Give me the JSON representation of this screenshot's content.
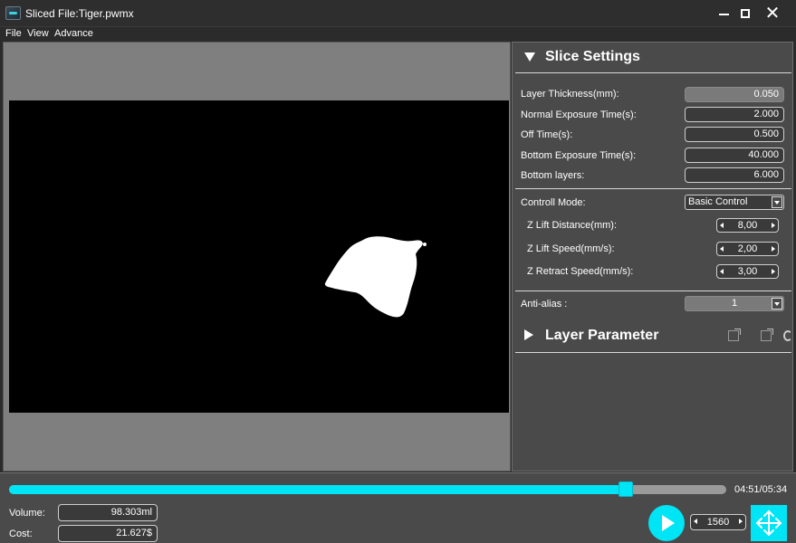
{
  "window": {
    "title": "Sliced File:Tiger.pwmx",
    "close_glyph": "✕"
  },
  "menu": [
    "File",
    "View",
    "Advance"
  ],
  "slice_settings": {
    "title": "Slice Settings",
    "layer_thickness": {
      "label": "Layer Thickness(mm):",
      "value": "0.050"
    },
    "normal_exposure": {
      "label": "Normal Exposure Time(s):",
      "value": "2.000"
    },
    "off_time": {
      "label": "Off Time(s):",
      "value": "0.500"
    },
    "bottom_exposure": {
      "label": "Bottom Exposure Time(s):",
      "value": "40.000"
    },
    "bottom_layers": {
      "label": "Bottom layers:",
      "value": "6.000"
    },
    "control_mode": {
      "label": "Controll Mode:",
      "value": "Basic Control"
    },
    "z_lift_distance": {
      "label": "Z Lift Distance(mm):",
      "value": "8,00"
    },
    "z_lift_speed": {
      "label": "Z Lift Speed(mm/s):",
      "value": "2,00"
    },
    "z_retract_speed": {
      "label": "Z Retract Speed(mm/s):",
      "value": "3,00"
    },
    "anti_alias": {
      "label": "Anti-alias :",
      "value": "1"
    }
  },
  "layer_parameter": {
    "title": "Layer Parameter"
  },
  "playback": {
    "time": "04:51/05:34",
    "progress": 0.86,
    "layer": "1560"
  },
  "stats": {
    "volume": {
      "label": "Volume:",
      "value": "98.303ml"
    },
    "cost": {
      "label": "Cost:",
      "value": "21.627$"
    }
  },
  "colors": {
    "accent": "#00e5f5",
    "panel": "#4a4a4a",
    "viewer_bg": "#7f7f7f",
    "canvas": "#000000"
  },
  "icons": [
    "app-icon",
    "minimize-icon",
    "maximize-icon",
    "close-icon",
    "collapse-triangle-icon",
    "expand-triangle-icon",
    "export-icon",
    "import-icon",
    "loading-icon",
    "play-icon",
    "move-arrows-icon"
  ]
}
